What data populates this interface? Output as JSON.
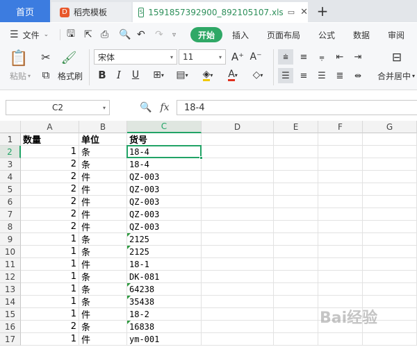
{
  "tabs": {
    "home": "首页",
    "template": "稻壳模板",
    "file": "1591857392900_892105107.xls",
    "add": "+"
  },
  "menu": {
    "file": "文件",
    "start": "开始",
    "insert": "插入",
    "layout": "页面布局",
    "formula": "公式",
    "data": "数据",
    "review": "审阅"
  },
  "ribbon": {
    "paste": "粘贴",
    "format_painter": "格式刷",
    "font_name": "宋体",
    "font_size": "11",
    "merge_center": "合并居中"
  },
  "formula_bar": {
    "cell_ref": "C2",
    "fx": "fx",
    "value": "18-4"
  },
  "sheet": {
    "columns": [
      "A",
      "B",
      "C",
      "D",
      "E",
      "F",
      "G"
    ],
    "header_row": {
      "a": "数量",
      "b": "单位",
      "c": "货号"
    },
    "rows": [
      {
        "n": "1",
        "a": "",
        "b": "",
        "c": "",
        "mark": false
      },
      {
        "n": "2",
        "a": "1",
        "b": "条",
        "c": "18-4",
        "mark": false
      },
      {
        "n": "3",
        "a": "2",
        "b": "条",
        "c": "18-4",
        "mark": false
      },
      {
        "n": "4",
        "a": "2",
        "b": "件",
        "c": "QZ-003",
        "mark": false
      },
      {
        "n": "5",
        "a": "2",
        "b": "件",
        "c": "QZ-003",
        "mark": false
      },
      {
        "n": "6",
        "a": "2",
        "b": "件",
        "c": "QZ-003",
        "mark": false
      },
      {
        "n": "7",
        "a": "2",
        "b": "件",
        "c": "QZ-003",
        "mark": false
      },
      {
        "n": "8",
        "a": "2",
        "b": "件",
        "c": "QZ-003",
        "mark": false
      },
      {
        "n": "9",
        "a": "1",
        "b": "条",
        "c": "2125",
        "mark": true
      },
      {
        "n": "10",
        "a": "1",
        "b": "条",
        "c": "2125",
        "mark": true
      },
      {
        "n": "11",
        "a": "1",
        "b": "件",
        "c": "18-1",
        "mark": false
      },
      {
        "n": "12",
        "a": "1",
        "b": "条",
        "c": "DK-081",
        "mark": false
      },
      {
        "n": "13",
        "a": "1",
        "b": "条",
        "c": "64238",
        "mark": true
      },
      {
        "n": "14",
        "a": "1",
        "b": "条",
        "c": "35438",
        "mark": true
      },
      {
        "n": "15",
        "a": "1",
        "b": "件",
        "c": "18-2",
        "mark": false
      },
      {
        "n": "16",
        "a": "2",
        "b": "条",
        "c": "16838",
        "mark": true
      },
      {
        "n": "17",
        "a": "1",
        "b": "件",
        "c": "ym-001",
        "mark": false
      }
    ]
  },
  "watermark": "Bai经验",
  "colors": {
    "accent_green": "#21a366",
    "home_tab": "#3c7ce0",
    "start_pill": "#2fa866"
  }
}
